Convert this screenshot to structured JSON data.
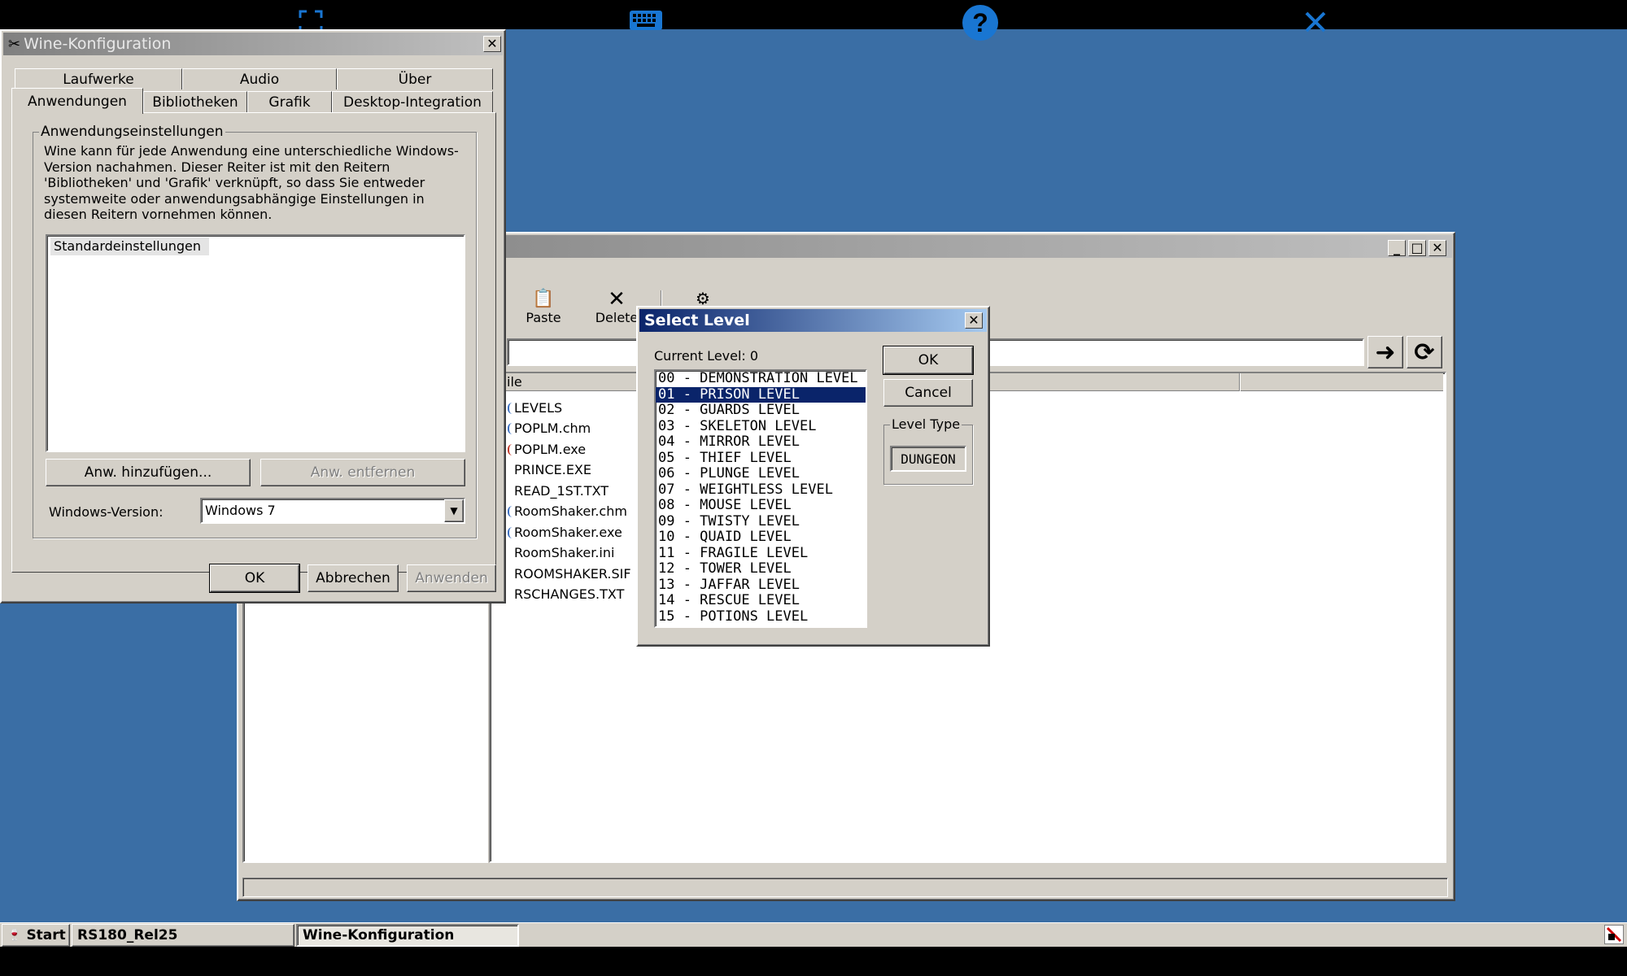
{
  "top_bar": {
    "icons": [
      "fullscreen-icon",
      "keyboard-icon",
      "help-icon",
      "close-icon"
    ],
    "accent": "#1976d2"
  },
  "wine_config": {
    "title": "Wine-Konfiguration",
    "tabs_row1": [
      "Laufwerke",
      "Audio",
      "Über"
    ],
    "tabs_row2": [
      "Anwendungen",
      "Bibliotheken",
      "Grafik",
      "Desktop-Integration"
    ],
    "group_label": "Anwendungseinstellungen",
    "description": "Wine kann für jede Anwendung eine unterschiedliche Windows-Version nachahmen. Dieser Reiter ist mit den Reitern 'Bibliotheken' und 'Grafik' verknüpft, so dass Sie entweder systemweite oder anwendungsabhängige Einstellungen in diesen Reitern vornehmen können.",
    "app_list": [
      "Standardeinstellungen"
    ],
    "add_button": "Anw. hinzufügen...",
    "remove_button": "Anw. entfernen",
    "version_label": "Windows-Version:",
    "version_value": "Windows 7",
    "ok": "OK",
    "cancel": "Abbrechen",
    "apply": "Anwenden"
  },
  "main_window": {
    "toolbar": {
      "paste": "Paste",
      "delete": "Delete"
    },
    "column_header": "ile",
    "files": [
      "LEVELS",
      "POPLM.chm",
      "POPLM.exe",
      "PRINCE.EXE",
      "READ_1ST.TXT",
      "RoomShaker.chm",
      "RoomShaker.exe",
      "RoomShaker.ini",
      "ROOMSHAKER.SIF",
      "RSCHANGES.TXT"
    ]
  },
  "select_level": {
    "title": "Select Level",
    "current_level": "Current Level: 0",
    "levels": [
      "00 - DEMONSTRATION LEVEL",
      "01 - PRISON LEVEL",
      "02 - GUARDS LEVEL",
      "03 - SKELETON LEVEL",
      "04 - MIRROR LEVEL",
      "05 - THIEF LEVEL",
      "06 - PLUNGE LEVEL",
      "07 - WEIGHTLESS LEVEL",
      "08 - MOUSE LEVEL",
      "09 - TWISTY LEVEL",
      "10 - QUAID LEVEL",
      "11 - FRAGILE LEVEL",
      "12 - TOWER LEVEL",
      "13 - JAFFAR LEVEL",
      "14 - RESCUE LEVEL",
      "15 - POTIONS LEVEL"
    ],
    "selected": "01 - PRISON LEVEL",
    "ok": "OK",
    "cancel": "Cancel",
    "level_type_label": "Level Type",
    "level_type_value": "DUNGEON"
  },
  "taskbar": {
    "start": "Start",
    "items": [
      "RS180_Rel25",
      "Wine-Konfiguration"
    ]
  }
}
